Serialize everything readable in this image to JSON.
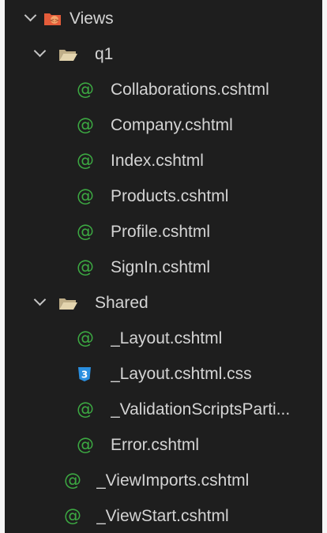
{
  "explorer": {
    "views_folder": {
      "label": "Views",
      "icon": "mvc-views-folder-icon",
      "expanded": true
    },
    "q1_folder": {
      "label": "q1",
      "icon": "folder-open-icon",
      "expanded": true,
      "files": [
        {
          "label": "Collaborations.cshtml",
          "icon": "razor-at-icon"
        },
        {
          "label": "Company.cshtml",
          "icon": "razor-at-icon"
        },
        {
          "label": "Index.cshtml",
          "icon": "razor-at-icon"
        },
        {
          "label": "Products.cshtml",
          "icon": "razor-at-icon"
        },
        {
          "label": "Profile.cshtml",
          "icon": "razor-at-icon"
        },
        {
          "label": "SignIn.cshtml",
          "icon": "razor-at-icon"
        }
      ]
    },
    "shared_folder": {
      "label": "Shared",
      "icon": "folder-open-icon",
      "expanded": true,
      "files": [
        {
          "label": "_Layout.cshtml",
          "icon": "razor-at-icon"
        },
        {
          "label": "_Layout.cshtml.css",
          "icon": "css3-icon"
        },
        {
          "label": "_ValidationScriptsParti...",
          "icon": "razor-at-icon"
        },
        {
          "label": "Error.cshtml",
          "icon": "razor-at-icon"
        }
      ]
    },
    "root_files": [
      {
        "label": "_ViewImports.cshtml",
        "icon": "razor-at-icon"
      },
      {
        "label": "_ViewStart.cshtml",
        "icon": "razor-at-icon"
      }
    ],
    "razor_glyph": "@",
    "css_glyph": "3",
    "colors": {
      "background": "#1e1e1e",
      "text": "#d4d4d4",
      "razor_green": "#3ca842",
      "css_blue": "#2a8fe0",
      "folder_tan": "#d7c8a4",
      "views_orange": "#e45c3a"
    }
  }
}
